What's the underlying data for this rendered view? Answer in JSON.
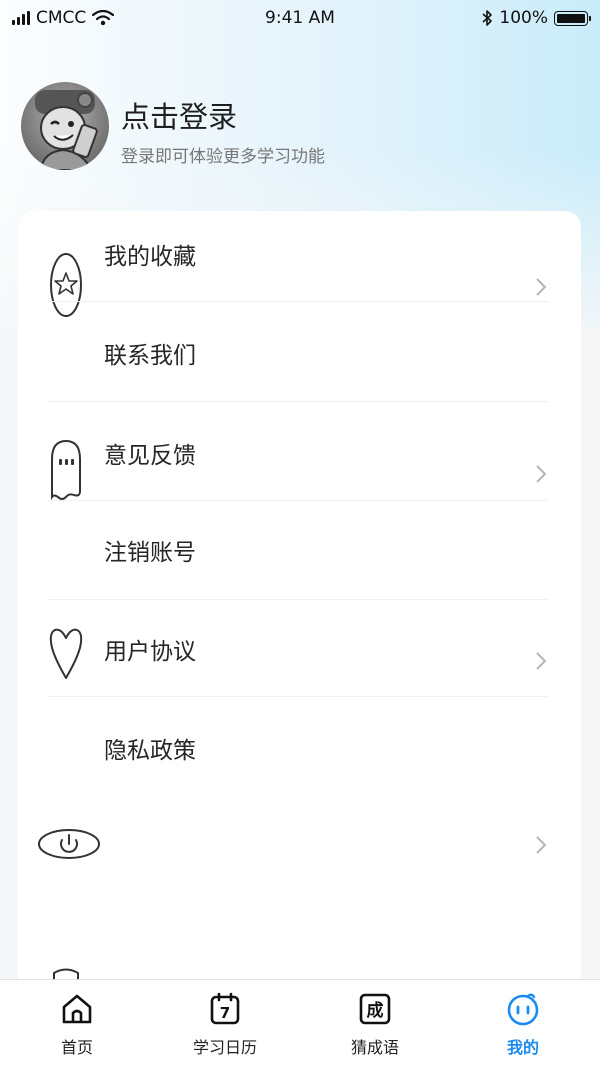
{
  "status_bar": {
    "carrier": "CMCC",
    "time": "9:41 AM",
    "battery": "100%"
  },
  "profile": {
    "title": "点击登录",
    "subtitle": "登录即可体验更多学习功能"
  },
  "menu": {
    "favorites": "我的收藏",
    "contact": "联系我们",
    "feedback": "意见反馈",
    "cancel_account": "注销账号",
    "agreement": "用户协议",
    "privacy": "隐私政策"
  },
  "tabbar": {
    "home": "首页",
    "calendar": "学习日历",
    "calendar_day": "7",
    "idiom": "猜成语",
    "idiom_glyph": "成",
    "mine": "我的"
  },
  "colors": {
    "accent": "#1b8cf0"
  }
}
